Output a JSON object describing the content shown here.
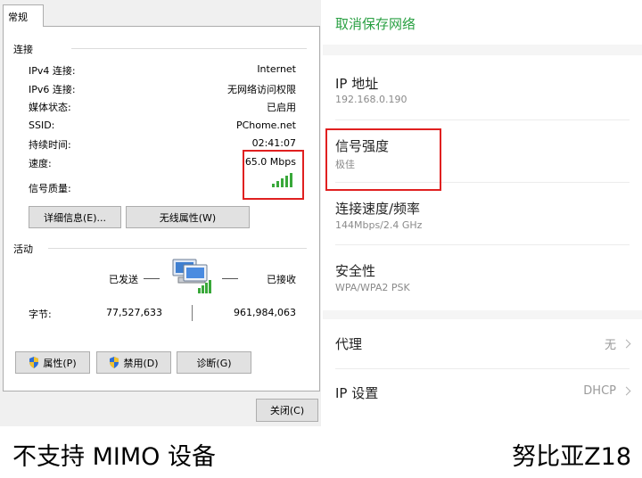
{
  "win": {
    "tab": "常规",
    "group_connection": "连接",
    "rows": [
      {
        "k": "IPv4 连接:",
        "v": "Internet"
      },
      {
        "k": "IPv6 连接:",
        "v": "无网络访问权限"
      },
      {
        "k": "媒体状态:",
        "v": "已启用"
      },
      {
        "k": "SSID:",
        "v": "PChome.net"
      },
      {
        "k": "持续时间:",
        "v": "02:41:07"
      },
      {
        "k": "速度:",
        "v": "65.0 Mbps"
      }
    ],
    "signal_label": "信号质量:",
    "details_btn": "详细信息(E)...",
    "wireless_btn": "无线属性(W)",
    "group_activity": "活动",
    "sent_label": "已发送",
    "recv_label": "已接收",
    "bytes_label": "字节:",
    "bytes_sent": "77,527,633",
    "bytes_recv": "961,984,063",
    "props_btn": "属性(P)",
    "disable_btn": "禁用(D)",
    "diag_btn": "诊断(G)",
    "close_btn": "关闭(C)",
    "signal_bars": 5
  },
  "droid": {
    "cancel": "取消保存网络",
    "items": [
      {
        "title": "IP 地址",
        "sub": "192.168.0.190"
      },
      {
        "title": "信号强度",
        "sub": "极佳"
      },
      {
        "title": "连接速度/频率",
        "sub": "144Mbps/2.4 GHz"
      },
      {
        "title": "安全性",
        "sub": "WPA/WPA2 PSK"
      }
    ],
    "proxy": {
      "title": "代理",
      "value": "无"
    },
    "ip_settings": {
      "title": "IP 设置",
      "value": "DHCP"
    }
  },
  "captions": {
    "left": "不支持 MIMO 设备",
    "right": "努比亚Z18"
  },
  "colors": {
    "highlight_border": "#e02020",
    "android_accent": "#2aa043",
    "signal_green": "#39a83a"
  }
}
